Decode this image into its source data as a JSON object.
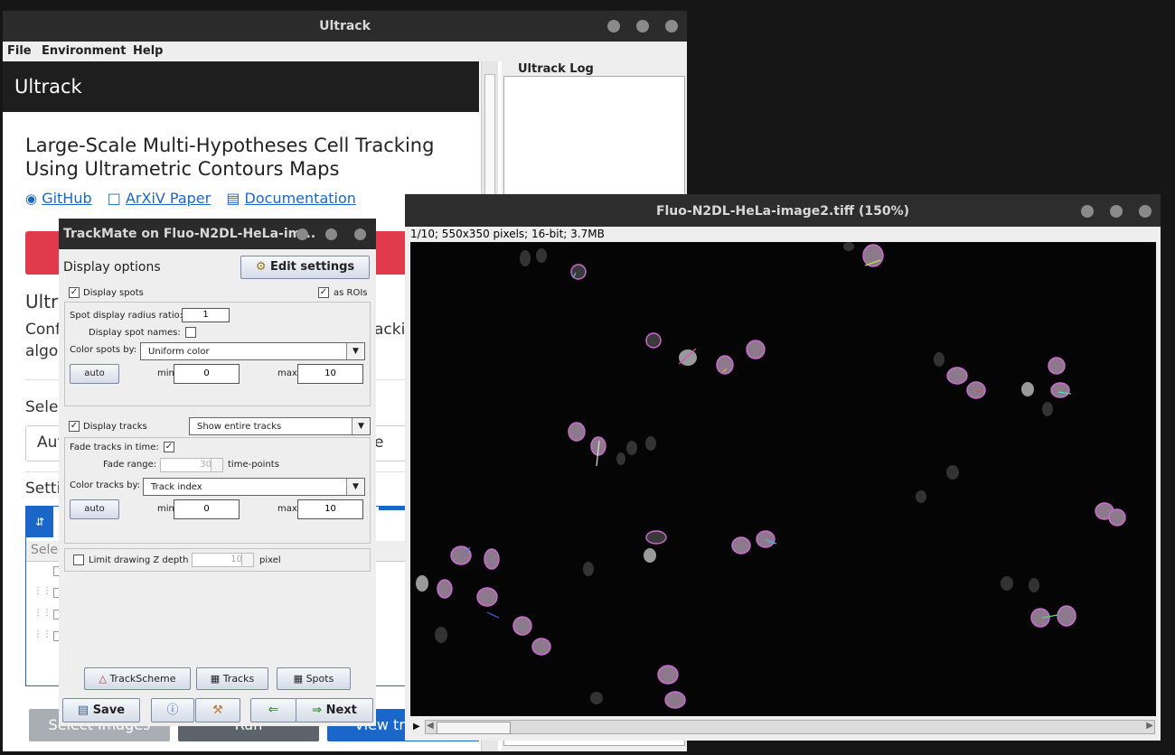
{
  "ultrack": {
    "window_title": "Ultrack",
    "menu": [
      "File",
      "Environment",
      "Help"
    ],
    "header": "Ultrack",
    "title": "Large-Scale Multi-Hypotheses Cell Tracking Using Ultrametric Contours Maps",
    "links": [
      "GitHub",
      "ArXiV Paper",
      "Documentation"
    ],
    "section_heading": "Ultra",
    "desc_line1": "Conf",
    "desc_line1_right": "acking",
    "desc_line2": "algo",
    "select_label": "Selec",
    "select_value": "Aut",
    "select_value_right": "e",
    "settings_label": "Setti",
    "table_header": "Selec",
    "buttons": [
      "Select Images",
      "Run",
      "View tr"
    ],
    "log_title": "Ultrack Log"
  },
  "trackmate": {
    "window_title": "TrackMate on Fluo-N2DL-HeLa-im...",
    "display_options": "Display options",
    "edit_settings": "Edit settings",
    "display_spots": "Display spots",
    "display_spots_checked": true,
    "as_rois": "as ROIs",
    "as_rois_checked": true,
    "radius_label": "Spot display radius ratio:",
    "radius_value": "1",
    "spot_names_label": "Display spot names:",
    "spot_names_checked": false,
    "color_spots_label": "Color spots by:",
    "color_spots_value": "Uniform color",
    "auto": "auto",
    "min_label": "min",
    "max_label": "max",
    "spots_min": "0",
    "spots_max": "10",
    "display_tracks": "Display tracks",
    "display_tracks_checked": true,
    "track_mode": "Show entire tracks",
    "fade_label": "Fade tracks in time:",
    "fade_checked": true,
    "fade_range_label": "Fade range:",
    "fade_range_value": "30",
    "fade_unit": "time-points",
    "color_tracks_label": "Color tracks by:",
    "color_tracks_value": "Track index",
    "tracks_min": "0",
    "tracks_max": "10",
    "limit_z_label": "Limit drawing Z depth",
    "limit_z_checked": false,
    "z_value": "10",
    "z_unit": "pixel",
    "trackscheme": "TrackScheme",
    "tracks_btn": "Tracks",
    "spots_btn": "Spots",
    "save": "Save",
    "next": "Next"
  },
  "image_window": {
    "title": "Fluo-N2DL-HeLa-image2.tiff (150%)",
    "info": "1/10; 550x350 pixels; 16-bit; 3.7MB"
  },
  "icons": [
    "github-icon",
    "pdf-icon",
    "book-icon",
    "gear-icon",
    "info-icon",
    "wrench-icon",
    "arrow-left-icon",
    "arrow-right-icon",
    "play-icon"
  ],
  "colors": {
    "accent_blue": "#1a67c9",
    "red_banner": "#e03a4b",
    "spot_magenta": "#d16ad6"
  }
}
